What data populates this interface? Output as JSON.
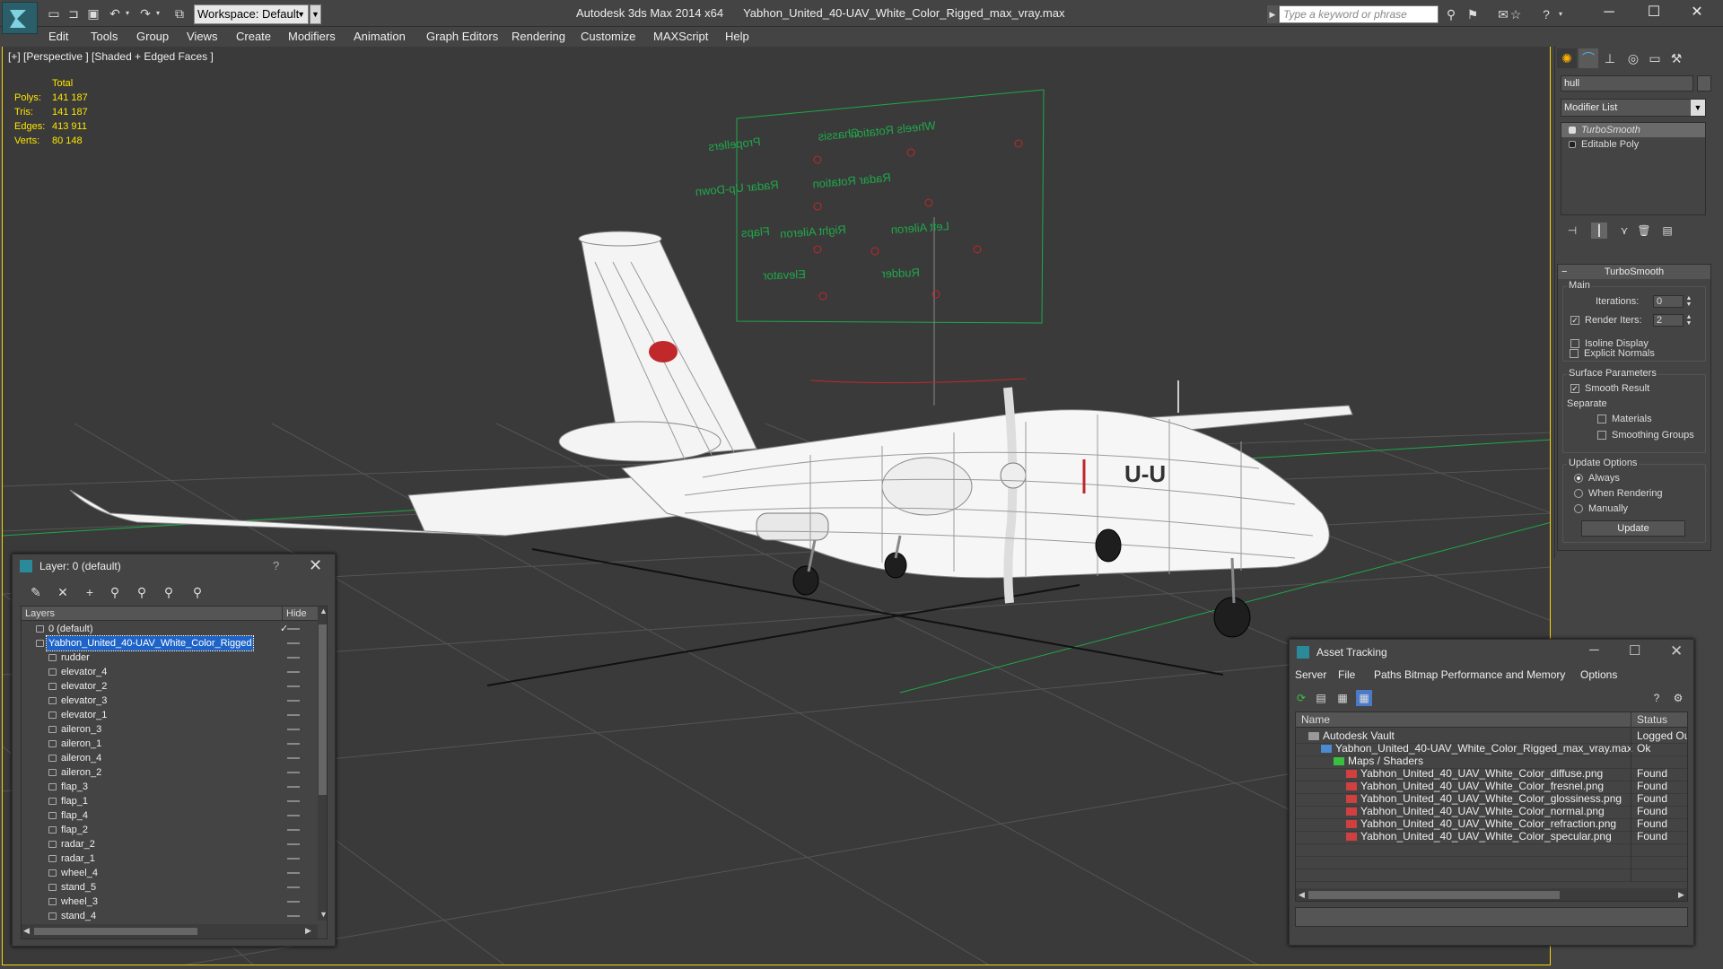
{
  "titlebar": {
    "workspace": "Workspace: Default",
    "app_title": "Autodesk 3ds Max 2014 x64",
    "file_title": "Yabhon_United_40-UAV_White_Color_Rigged_max_vray.max",
    "search_placeholder": "Type a keyword or phrase"
  },
  "menu": [
    "Edit",
    "Tools",
    "Group",
    "Views",
    "Create",
    "Modifiers",
    "Animation",
    "Graph Editors",
    "Rendering",
    "Customize",
    "MAXScript",
    "Help"
  ],
  "viewport": {
    "label": "[+] [Perspective ] [Shaded + Edged Faces ]",
    "stats_header": "Total",
    "stats": [
      {
        "k": "Polys:",
        "v": "141 187"
      },
      {
        "k": "Tris:",
        "v": "141 187"
      },
      {
        "k": "Edges:",
        "v": "413 911"
      },
      {
        "k": "Verts:",
        "v": "80 148"
      }
    ],
    "rig_labels": [
      "Propellers",
      "Chassis",
      "Wheels Rotation",
      "Radar Up-Down",
      "Radar Rotation",
      "Flaps",
      "Right Aileron",
      "Left Aileron",
      "Elevator",
      "Rudder"
    ],
    "colors": {
      "accent": "#ffd200",
      "stats": "#ffe600",
      "rig": "#1fa84a",
      "grid": "#5a5a5a"
    }
  },
  "cmdpanel": {
    "object_name": "hull",
    "modifier_list": "Modifier List",
    "stack": [
      "TurboSmooth",
      "Editable Poly"
    ],
    "rollout_title": "TurboSmooth",
    "main_group": "Main",
    "iterations_label": "Iterations:",
    "iterations": "0",
    "render_iters_label": "Render Iters:",
    "render_iters": "2",
    "isoline": "Isoline Display",
    "explicit_normals": "Explicit Normals",
    "surface_group": "Surface Parameters",
    "smooth_result": "Smooth Result",
    "separate": "Separate",
    "materials": "Materials",
    "smoothing_groups": "Smoothing Groups",
    "update_group": "Update Options",
    "always": "Always",
    "when_rendering": "When Rendering",
    "manually": "Manually",
    "update_button": "Update"
  },
  "layer_dialog": {
    "title": "Layer: 0 (default)",
    "help": "?",
    "col_layers": "Layers",
    "col_hide": "Hide",
    "rows": [
      {
        "name": "0 (default)",
        "level": 0,
        "check": "✓"
      },
      {
        "name": "Yabhon_United_40-UAV_White_Color_Rigged",
        "level": 0,
        "selected": true
      },
      {
        "name": "rudder",
        "level": 1
      },
      {
        "name": "elevator_4",
        "level": 1
      },
      {
        "name": "elevator_2",
        "level": 1
      },
      {
        "name": "elevator_3",
        "level": 1
      },
      {
        "name": "elevator_1",
        "level": 1
      },
      {
        "name": "aileron_3",
        "level": 1
      },
      {
        "name": "aileron_1",
        "level": 1
      },
      {
        "name": "aileron_4",
        "level": 1
      },
      {
        "name": "aileron_2",
        "level": 1
      },
      {
        "name": "flap_3",
        "level": 1
      },
      {
        "name": "flap_1",
        "level": 1
      },
      {
        "name": "flap_4",
        "level": 1
      },
      {
        "name": "flap_2",
        "level": 1
      },
      {
        "name": "radar_2",
        "level": 1
      },
      {
        "name": "radar_1",
        "level": 1
      },
      {
        "name": "wheel_4",
        "level": 1
      },
      {
        "name": "stand_5",
        "level": 1
      },
      {
        "name": "wheel_3",
        "level": 1
      },
      {
        "name": "stand_4",
        "level": 1
      }
    ]
  },
  "asset_tracking": {
    "title": "Asset Tracking",
    "menu": [
      "Server",
      "File",
      "Paths",
      "Bitmap Performance and Memory",
      "Options"
    ],
    "col_name": "Name",
    "col_status": "Status",
    "rows": [
      {
        "name": "Autodesk Vault",
        "status": "Logged Out",
        "level": 0,
        "icon": "vault"
      },
      {
        "name": "Yabhon_United_40-UAV_White_Color_Rigged_max_vray.max",
        "status": "Ok",
        "level": 1,
        "icon": "max"
      },
      {
        "name": "Maps / Shaders",
        "status": "",
        "level": 2,
        "icon": "folder"
      },
      {
        "name": "Yabhon_United_40_UAV_White_Color_diffuse.png",
        "status": "Found",
        "level": 3,
        "icon": "png"
      },
      {
        "name": "Yabhon_United_40_UAV_White_Color_fresnel.png",
        "status": "Found",
        "level": 3,
        "icon": "png"
      },
      {
        "name": "Yabhon_United_40_UAV_White_Color_glossiness.png",
        "status": "Found",
        "level": 3,
        "icon": "png"
      },
      {
        "name": "Yabhon_United_40_UAV_White_Color_normal.png",
        "status": "Found",
        "level": 3,
        "icon": "png"
      },
      {
        "name": "Yabhon_United_40_UAV_White_Color_refraction.png",
        "status": "Found",
        "level": 3,
        "icon": "png"
      },
      {
        "name": "Yabhon_United_40_UAV_White_Color_specular.png",
        "status": "Found",
        "level": 3,
        "icon": "png"
      }
    ]
  }
}
